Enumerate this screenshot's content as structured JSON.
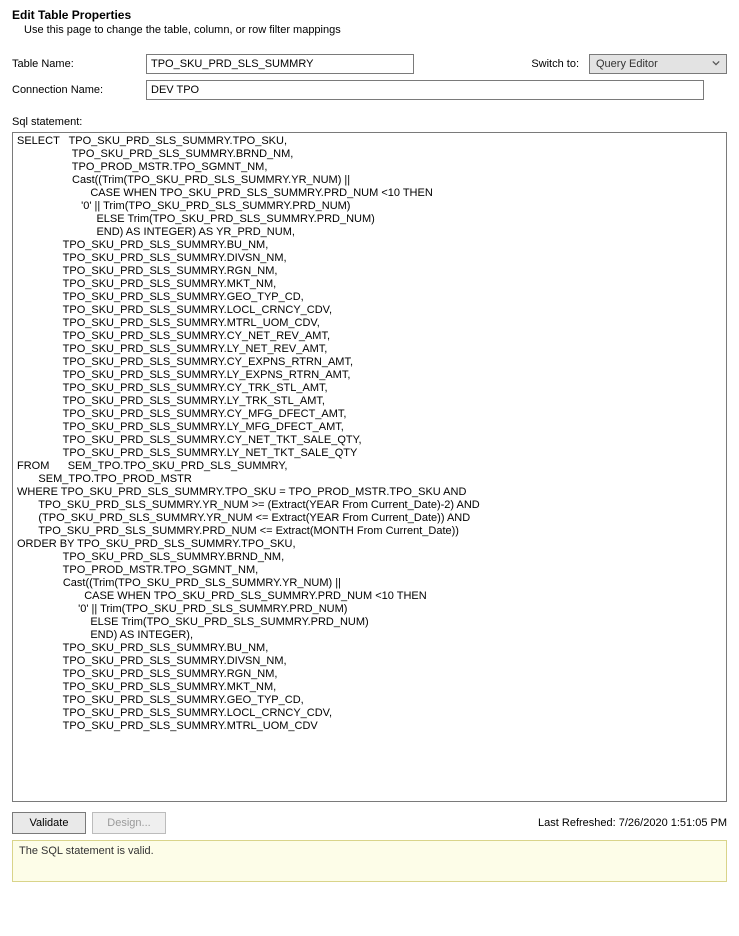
{
  "header": {
    "title": "Edit Table Properties",
    "subtitle": "Use this page to change the table, column, or row filter mappings"
  },
  "labels": {
    "table_name": "Table Name:",
    "connection_name": "Connection Name:",
    "switch_to": "Switch to:",
    "sql_statement": "Sql statement:"
  },
  "fields": {
    "table_name": "TPO_SKU_PRD_SLS_SUMMRY",
    "connection_name": "DEV TPO",
    "switch_to_selected": "Query Editor"
  },
  "sql": "SELECT   TPO_SKU_PRD_SLS_SUMMRY.TPO_SKU,\n                  TPO_SKU_PRD_SLS_SUMMRY.BRND_NM,\n                  TPO_PROD_MSTR.TPO_SGMNT_NM,\n                  Cast((Trim(TPO_SKU_PRD_SLS_SUMMRY.YR_NUM) ||\n                        CASE WHEN TPO_SKU_PRD_SLS_SUMMRY.PRD_NUM <10 THEN\n                     '0' || Trim(TPO_SKU_PRD_SLS_SUMMRY.PRD_NUM)\n                          ELSE Trim(TPO_SKU_PRD_SLS_SUMMRY.PRD_NUM)\n                          END) AS INTEGER) AS YR_PRD_NUM,\n               TPO_SKU_PRD_SLS_SUMMRY.BU_NM,\n               TPO_SKU_PRD_SLS_SUMMRY.DIVSN_NM,\n               TPO_SKU_PRD_SLS_SUMMRY.RGN_NM,\n               TPO_SKU_PRD_SLS_SUMMRY.MKT_NM,\n               TPO_SKU_PRD_SLS_SUMMRY.GEO_TYP_CD,\n               TPO_SKU_PRD_SLS_SUMMRY.LOCL_CRNCY_CDV,\n               TPO_SKU_PRD_SLS_SUMMRY.MTRL_UOM_CDV,\n               TPO_SKU_PRD_SLS_SUMMRY.CY_NET_REV_AMT,\n               TPO_SKU_PRD_SLS_SUMMRY.LY_NET_REV_AMT,\n               TPO_SKU_PRD_SLS_SUMMRY.CY_EXPNS_RTRN_AMT,\n               TPO_SKU_PRD_SLS_SUMMRY.LY_EXPNS_RTRN_AMT,\n               TPO_SKU_PRD_SLS_SUMMRY.CY_TRK_STL_AMT,\n               TPO_SKU_PRD_SLS_SUMMRY.LY_TRK_STL_AMT,\n               TPO_SKU_PRD_SLS_SUMMRY.CY_MFG_DFECT_AMT,\n               TPO_SKU_PRD_SLS_SUMMRY.LY_MFG_DFECT_AMT,\n               TPO_SKU_PRD_SLS_SUMMRY.CY_NET_TKT_SALE_QTY,\n               TPO_SKU_PRD_SLS_SUMMRY.LY_NET_TKT_SALE_QTY\nFROM      SEM_TPO.TPO_SKU_PRD_SLS_SUMMRY,\n       SEM_TPO.TPO_PROD_MSTR\nWHERE TPO_SKU_PRD_SLS_SUMMRY.TPO_SKU = TPO_PROD_MSTR.TPO_SKU AND\n       TPO_SKU_PRD_SLS_SUMMRY.YR_NUM >= (Extract(YEAR From Current_Date)-2) AND\n       (TPO_SKU_PRD_SLS_SUMMRY.YR_NUM <= Extract(YEAR From Current_Date)) AND\n       TPO_SKU_PRD_SLS_SUMMRY.PRD_NUM <= Extract(MONTH From Current_Date))\nORDER BY TPO_SKU_PRD_SLS_SUMMRY.TPO_SKU,\n               TPO_SKU_PRD_SLS_SUMMRY.BRND_NM,\n               TPO_PROD_MSTR.TPO_SGMNT_NM,\n               Cast((Trim(TPO_SKU_PRD_SLS_SUMMRY.YR_NUM) ||\n                      CASE WHEN TPO_SKU_PRD_SLS_SUMMRY.PRD_NUM <10 THEN\n                    '0' || Trim(TPO_SKU_PRD_SLS_SUMMRY.PRD_NUM)\n                        ELSE Trim(TPO_SKU_PRD_SLS_SUMMRY.PRD_NUM)\n                        END) AS INTEGER),\n               TPO_SKU_PRD_SLS_SUMMRY.BU_NM,\n               TPO_SKU_PRD_SLS_SUMMRY.DIVSN_NM,\n               TPO_SKU_PRD_SLS_SUMMRY.RGN_NM,\n               TPO_SKU_PRD_SLS_SUMMRY.MKT_NM,\n               TPO_SKU_PRD_SLS_SUMMRY.GEO_TYP_CD,\n               TPO_SKU_PRD_SLS_SUMMRY.LOCL_CRNCY_CDV,\n               TPO_SKU_PRD_SLS_SUMMRY.MTRL_UOM_CDV",
  "buttons": {
    "validate": "Validate",
    "design": "Design..."
  },
  "status": {
    "last_refreshed_label": "Last Refreshed:",
    "last_refreshed_value": "7/26/2020 1:51:05 PM",
    "validation_message": "The SQL statement is valid."
  }
}
